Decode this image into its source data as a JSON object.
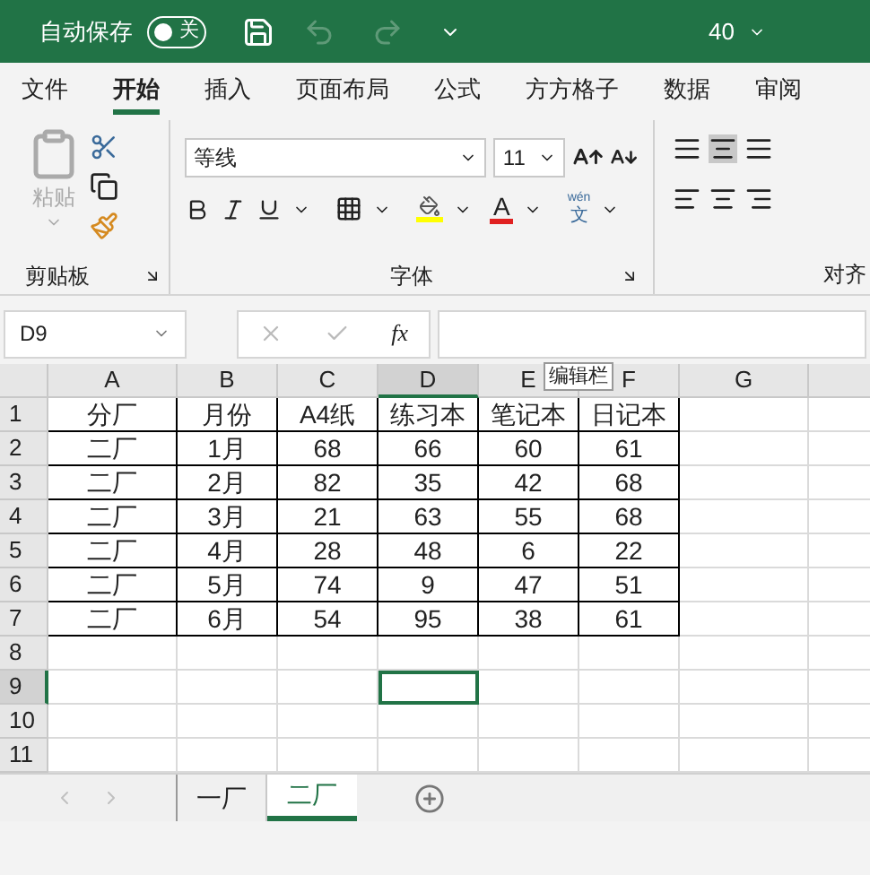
{
  "title_bar": {
    "autosave_label": "自动保存",
    "autosave": {
      "on": false,
      "label": "关"
    },
    "title": "40"
  },
  "menu_tabs": [
    {
      "label": "文件",
      "selected": false
    },
    {
      "label": "开始",
      "selected": true
    },
    {
      "label": "插入",
      "selected": false
    },
    {
      "label": "页面布局",
      "selected": false
    },
    {
      "label": "公式",
      "selected": false
    },
    {
      "label": "方方格子",
      "selected": false
    },
    {
      "label": "数据",
      "selected": false
    },
    {
      "label": "审阅",
      "selected": false
    }
  ],
  "ribbon": {
    "clipboard": {
      "paste_label": "粘贴",
      "group_label": "剪贴板"
    },
    "font": {
      "font_name": "等线",
      "font_size": "11",
      "font_color_label": "A",
      "phonetic_top": "wén",
      "phonetic_bottom": "文",
      "group_label": "字体"
    },
    "alignment": {
      "group_label": "对齐"
    }
  },
  "formula_bar": {
    "name_box": "D9",
    "function_label": "fx",
    "tooltip": "编辑栏"
  },
  "sheet": {
    "columns": [
      {
        "label": "A",
        "selected": false
      },
      {
        "label": "B",
        "selected": false
      },
      {
        "label": "C",
        "selected": false
      },
      {
        "label": "D",
        "selected": true
      },
      {
        "label": "E",
        "selected": false
      },
      {
        "label": "F",
        "selected": false
      },
      {
        "label": "G",
        "selected": false
      }
    ],
    "rows": [
      {
        "label": "1",
        "selected": false,
        "cells": [
          "分厂",
          "月份",
          "A4纸",
          "练习本",
          "笔记本",
          "日记本"
        ]
      },
      {
        "label": "2",
        "selected": false,
        "cells": [
          "二厂",
          "1月",
          "68",
          "66",
          "60",
          "61"
        ]
      },
      {
        "label": "3",
        "selected": false,
        "cells": [
          "二厂",
          "2月",
          "82",
          "35",
          "42",
          "68"
        ]
      },
      {
        "label": "4",
        "selected": false,
        "cells": [
          "二厂",
          "3月",
          "21",
          "63",
          "55",
          "68"
        ]
      },
      {
        "label": "5",
        "selected": false,
        "cells": [
          "二厂",
          "4月",
          "28",
          "48",
          "6",
          "22"
        ]
      },
      {
        "label": "6",
        "selected": false,
        "cells": [
          "二厂",
          "5月",
          "74",
          "9",
          "47",
          "51"
        ]
      },
      {
        "label": "7",
        "selected": false,
        "cells": [
          "二厂",
          "6月",
          "54",
          "95",
          "38",
          "61"
        ]
      },
      {
        "label": "8",
        "selected": false,
        "cells": []
      },
      {
        "label": "9",
        "selected": true,
        "cells": []
      },
      {
        "label": "10",
        "selected": false,
        "cells": []
      },
      {
        "label": "11",
        "selected": false,
        "cells": []
      }
    ]
  },
  "sheet_tabs": [
    {
      "label": "一厂",
      "selected": false
    },
    {
      "label": "二厂",
      "selected": true
    }
  ]
}
